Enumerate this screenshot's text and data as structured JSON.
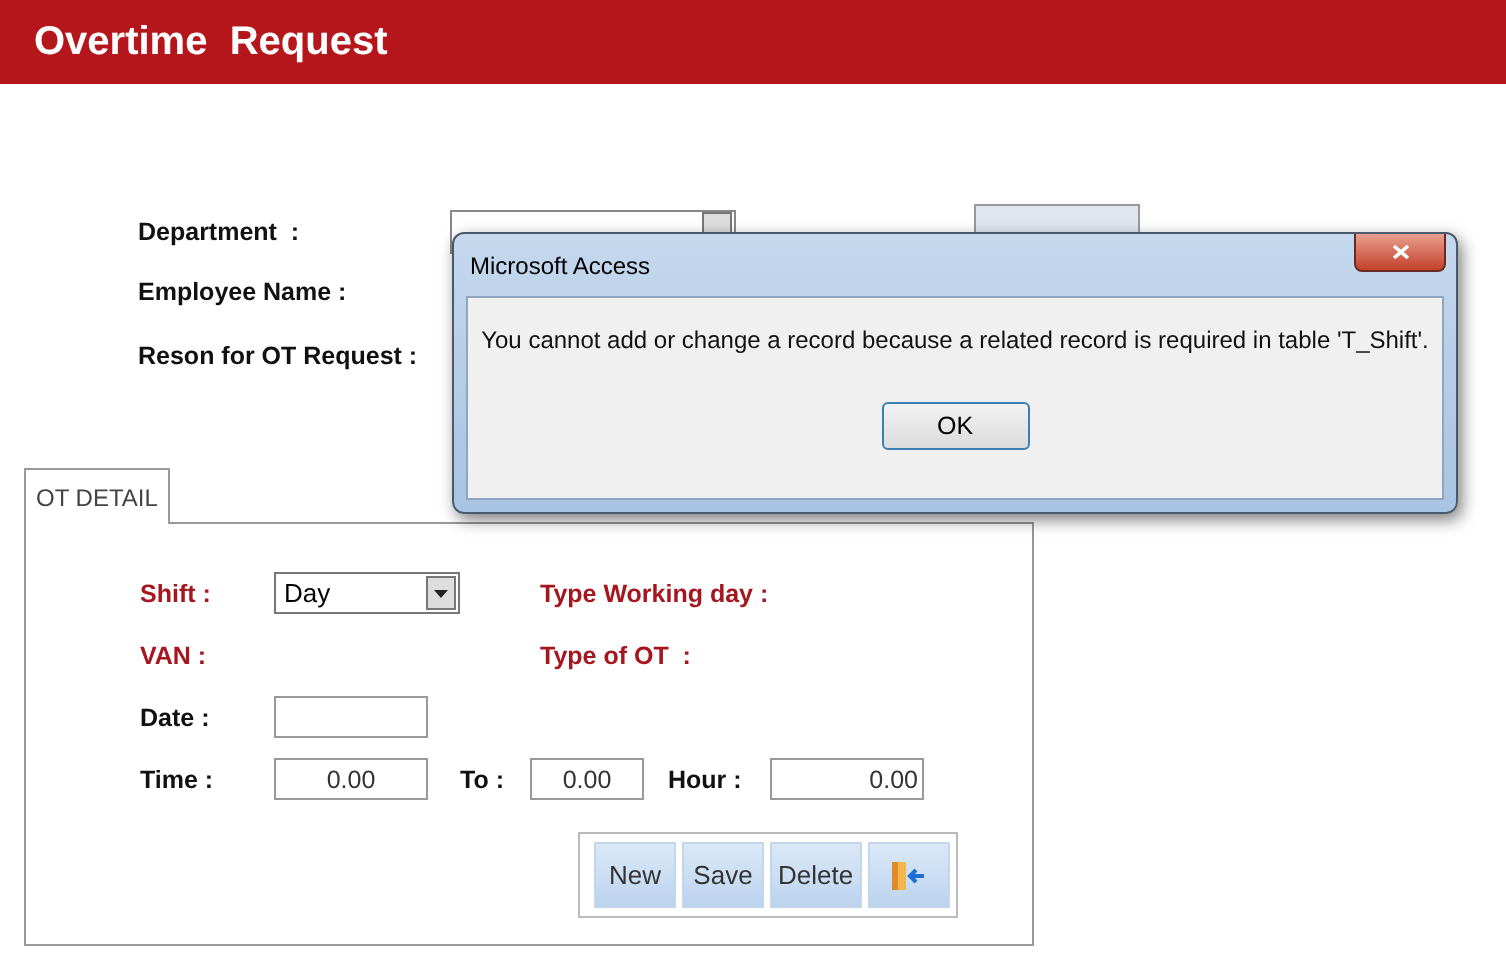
{
  "header": {
    "title": "Overtime  Request"
  },
  "form": {
    "department": {
      "label": "Department  :"
    },
    "employee_name": {
      "label": "Employee Name :"
    },
    "reason": {
      "label": "Reson for OT Request :"
    }
  },
  "tabs": [
    {
      "label": "OT DETAIL",
      "selected": true
    }
  ],
  "detail": {
    "shift": {
      "label": "Shift :",
      "required": true,
      "value": "Day"
    },
    "type_working_day": {
      "label": "Type Working day :",
      "required": true
    },
    "van": {
      "label": "VAN :",
      "required": true
    },
    "type_of_ot": {
      "label": "Type of OT  :",
      "required": true
    },
    "date": {
      "label": "Date :",
      "required": false
    },
    "time": {
      "label": "Time :",
      "required": false,
      "value": "0.00"
    },
    "to": {
      "label": "To :",
      "value": "0.00"
    },
    "hour": {
      "label": "Hour :",
      "value": "0.00"
    },
    "buttons": [
      {
        "kind": "text",
        "label": "New"
      },
      {
        "kind": "text",
        "label": "Save"
      },
      {
        "kind": "text",
        "label": "Delete"
      },
      {
        "kind": "exit"
      }
    ]
  },
  "dialog": {
    "title": "Microsoft Access",
    "message": "You cannot add or change a record because a related record is required in table 'T_Shift'.",
    "button": "OK"
  }
}
